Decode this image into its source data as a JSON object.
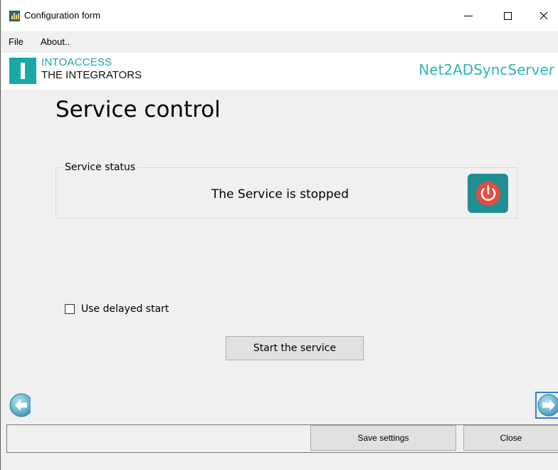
{
  "window": {
    "title": "Configuration form"
  },
  "menu": {
    "items": [
      "File",
      "About.."
    ]
  },
  "banner": {
    "logo_line1": "INTOACCESS",
    "logo_line2": "THE INTEGRATORS",
    "product": "Net2ADSyncServer",
    "accent_color": "#1aa7a7"
  },
  "main": {
    "title": "Service control",
    "status_group": {
      "legend": "Service status",
      "text": "The Service is stopped",
      "icon": "power-icon",
      "icon_color": "#e74c3c"
    },
    "delayed_start": {
      "label": "Use delayed start",
      "checked": false
    },
    "start_button": "Start the service"
  },
  "nav": {
    "back_icon": "arrow-left-icon",
    "next_icon": "arrow-right-icon"
  },
  "footer": {
    "save_label": "Save settings",
    "close_label": "Close"
  }
}
